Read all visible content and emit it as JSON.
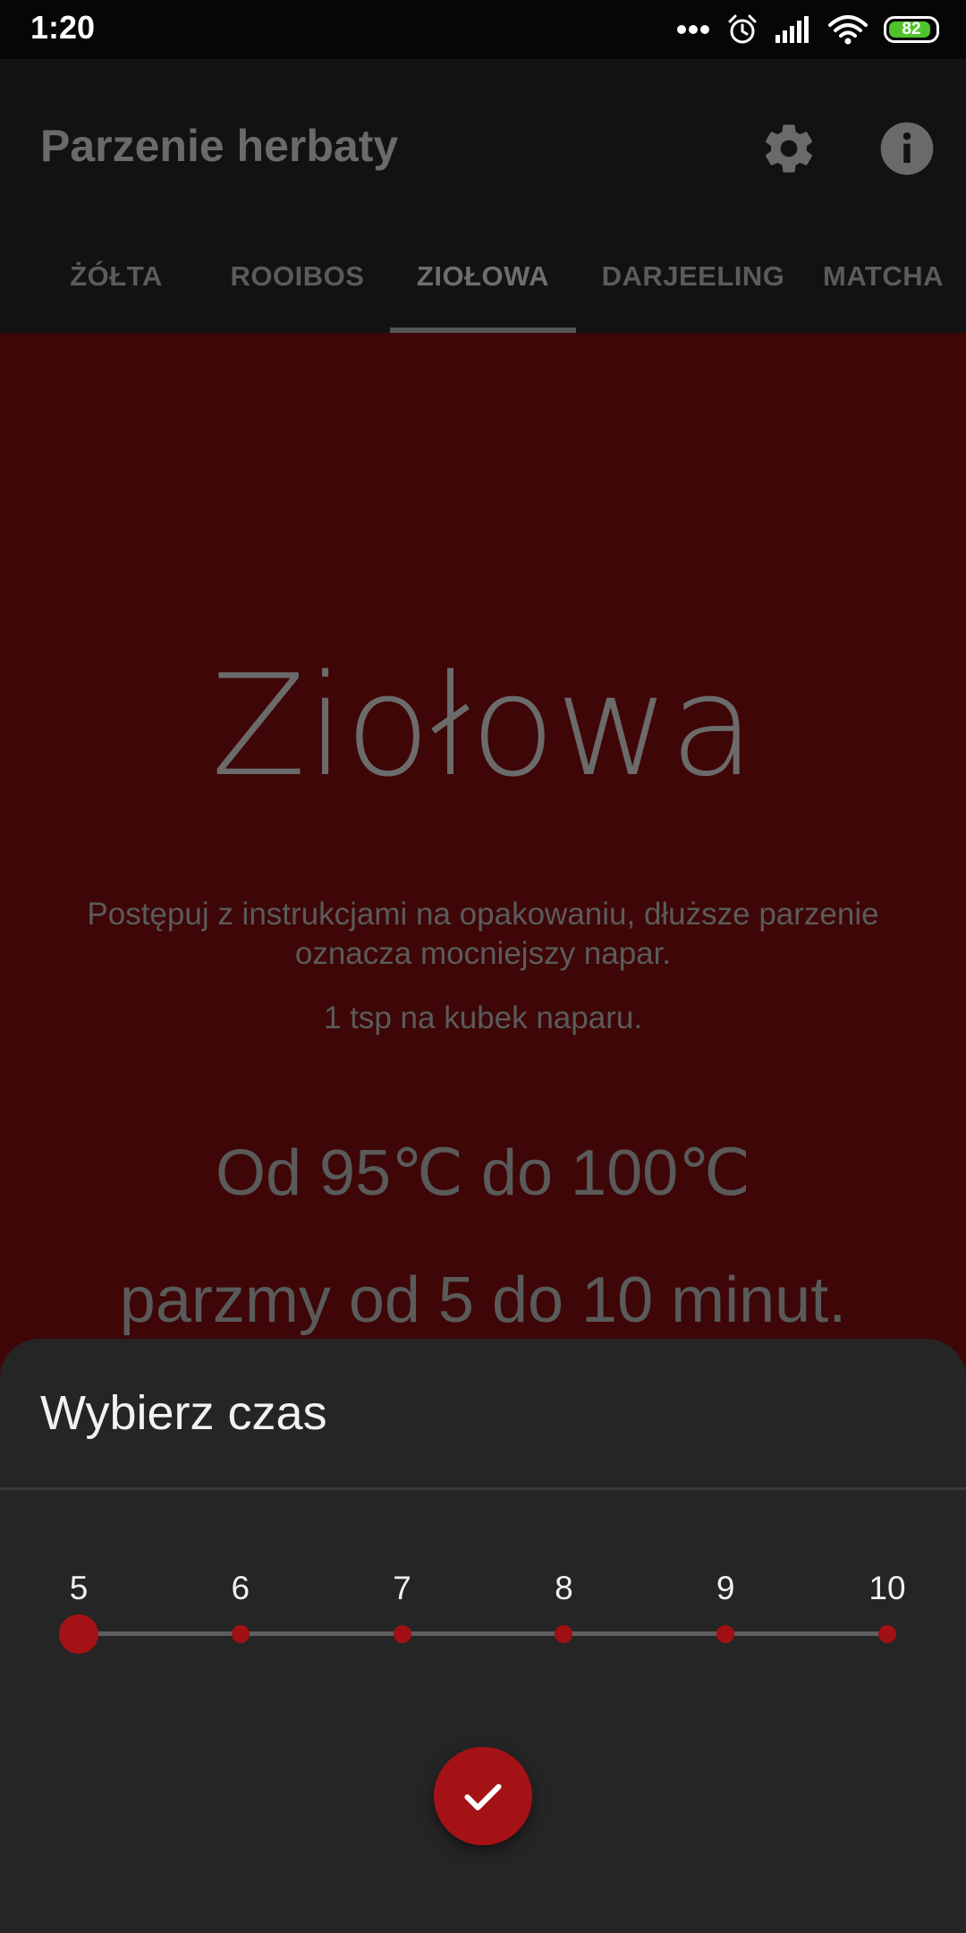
{
  "status_bar": {
    "time": "1:20",
    "battery": "82",
    "icons": [
      "more-dots-icon",
      "alarm-icon",
      "signal-icon",
      "wifi-icon",
      "battery-icon"
    ]
  },
  "app_bar": {
    "title": "Parzenie herbaty",
    "actions": [
      "settings-icon",
      "info-icon"
    ]
  },
  "tabs": [
    {
      "label": "ŻÓŁTA",
      "active": false
    },
    {
      "label": "ROOIBOS",
      "active": false
    },
    {
      "label": "ZIOŁOWA",
      "active": true
    },
    {
      "label": "DARJEELING",
      "active": false
    },
    {
      "label": "MATCHA",
      "active": false
    }
  ],
  "content": {
    "tea_name": "Ziołowa",
    "description": "Postępuj z instrukcjami na opakowaniu, dłuższe parzenie oznacza mocniejszy napar.",
    "dosage": "1 tsp na kubek naparu.",
    "temperature": "Od 95℃ do 100℃",
    "brew_time": "parzmy od 5 do 10 minut."
  },
  "time_picker": {
    "title": "Wybierz czas",
    "options": [
      "5",
      "6",
      "7",
      "8",
      "9",
      "10"
    ],
    "selected": "5",
    "confirm_icon": "check-icon"
  },
  "colors": {
    "accent": "#a51216",
    "content_background": "#3e0607",
    "sheet_background": "#252525",
    "app_bar": "#121212",
    "battery_fill": "#4fc42a"
  }
}
